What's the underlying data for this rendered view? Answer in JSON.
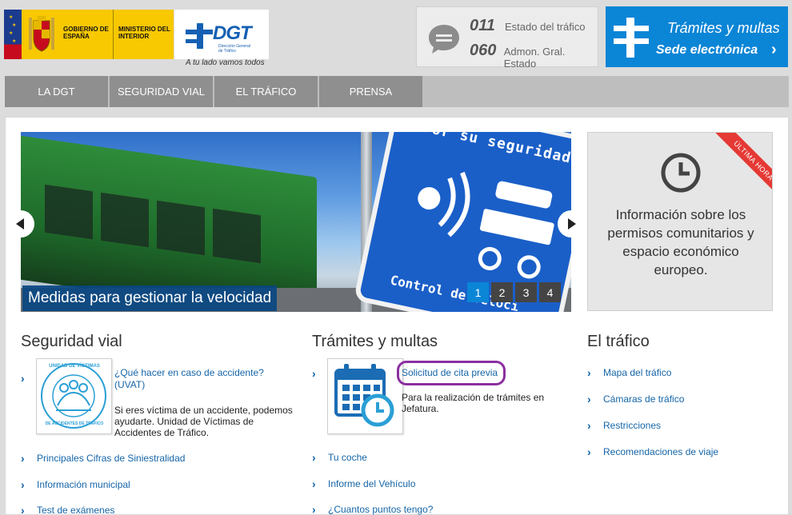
{
  "header": {
    "gov_gobierno": "GOBIERNO DE ESPAÑA",
    "gov_ministerio": "MINISTERIO DEL INTERIOR",
    "dgt_title": "DGT",
    "dgt_subtitle": "Dirección General de Tráfico",
    "slogan": "A tu lado vamos todos",
    "phones": [
      {
        "number": "011",
        "label": "Estado del tráfico"
      },
      {
        "number": "060",
        "label": "Admon. Gral. Estado"
      }
    ],
    "sede": {
      "line1": "Trámites y multas",
      "line2": "Sede electrónica"
    }
  },
  "nav": {
    "items": [
      "LA DGT",
      "SEGURIDAD VIAL",
      "EL TRÁFICO",
      "PRENSA"
    ]
  },
  "hero": {
    "caption": "Medidas para gestionar la velocidad",
    "sign_top": "Por su seguridad",
    "sign_bottom": "Control de veloci",
    "pages": [
      "1",
      "2",
      "3",
      "4"
    ],
    "active_page": "1"
  },
  "news": {
    "ribbon": "ÚLTIMA HORA",
    "text": "Información sobre los permisos comunitarios y espacio económico europeo."
  },
  "seguridad_vial": {
    "title": "Seguridad vial",
    "feature_link": "¿Qué hacer en caso de accidente? (UVAT)",
    "feature_text": "Si eres víctima de un accidente, podemos ayudarte. Unidad de Víctimas de Accidentes de Tráfico.",
    "badge_top": "UNIDAD DE VÍCTIMAS",
    "badge_bottom": "DE ACCIDENTES DE TRÁFICO",
    "links": [
      "Principales Cifras de Siniestralidad",
      "Información municipal",
      "Test de exámenes"
    ]
  },
  "tramites": {
    "title": "Trámites y multas",
    "feature_link": "Solicitud de cita previa",
    "feature_text": "Para la realización de trámites en Jefatura.",
    "links": [
      "Tu coche",
      "Informe del Vehículo",
      "¿Cuantos puntos tengo?"
    ]
  },
  "trafico": {
    "title": "El tráfico",
    "links": [
      "Mapa del tráfico",
      "Cámaras de tráfico",
      "Restricciones",
      "Recomendaciones de viaje"
    ]
  }
}
